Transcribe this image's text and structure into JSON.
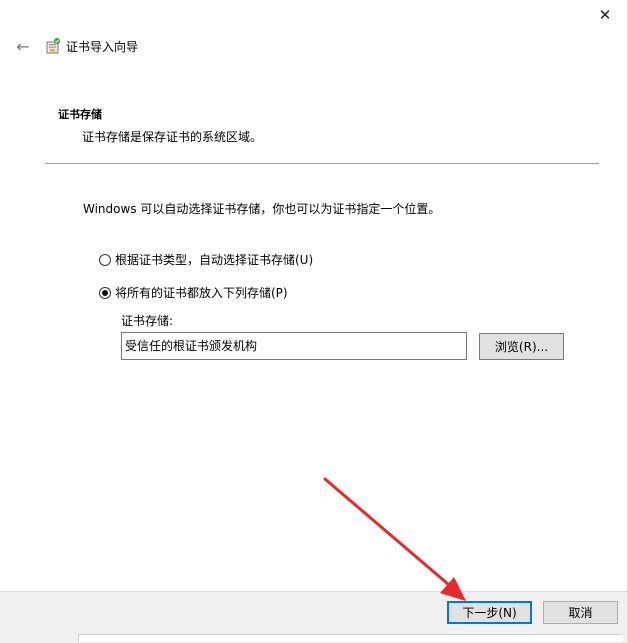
{
  "window": {
    "close_glyph": "✕",
    "back_glyph": "←",
    "title": "证书导入向导"
  },
  "section": {
    "title": "证书存储",
    "description": "证书存储是保存证书的系统区域。"
  },
  "main": {
    "intro": "Windows 可以自动选择证书存储，你也可以为证书指定一个位置。",
    "options": [
      {
        "label": "根据证书类型，自动选择证书存储(U)",
        "selected": false
      },
      {
        "label": "将所有的证书都放入下列存储(P)",
        "selected": true
      }
    ],
    "store_label": "证书存储:",
    "store_value": "受信任的根证书颁发机构",
    "browse_label": "浏览(R)..."
  },
  "footer": {
    "next_label": "下一步(N)",
    "cancel_label": "取消"
  },
  "annotation": {
    "arrow_color": "#e8292b"
  }
}
